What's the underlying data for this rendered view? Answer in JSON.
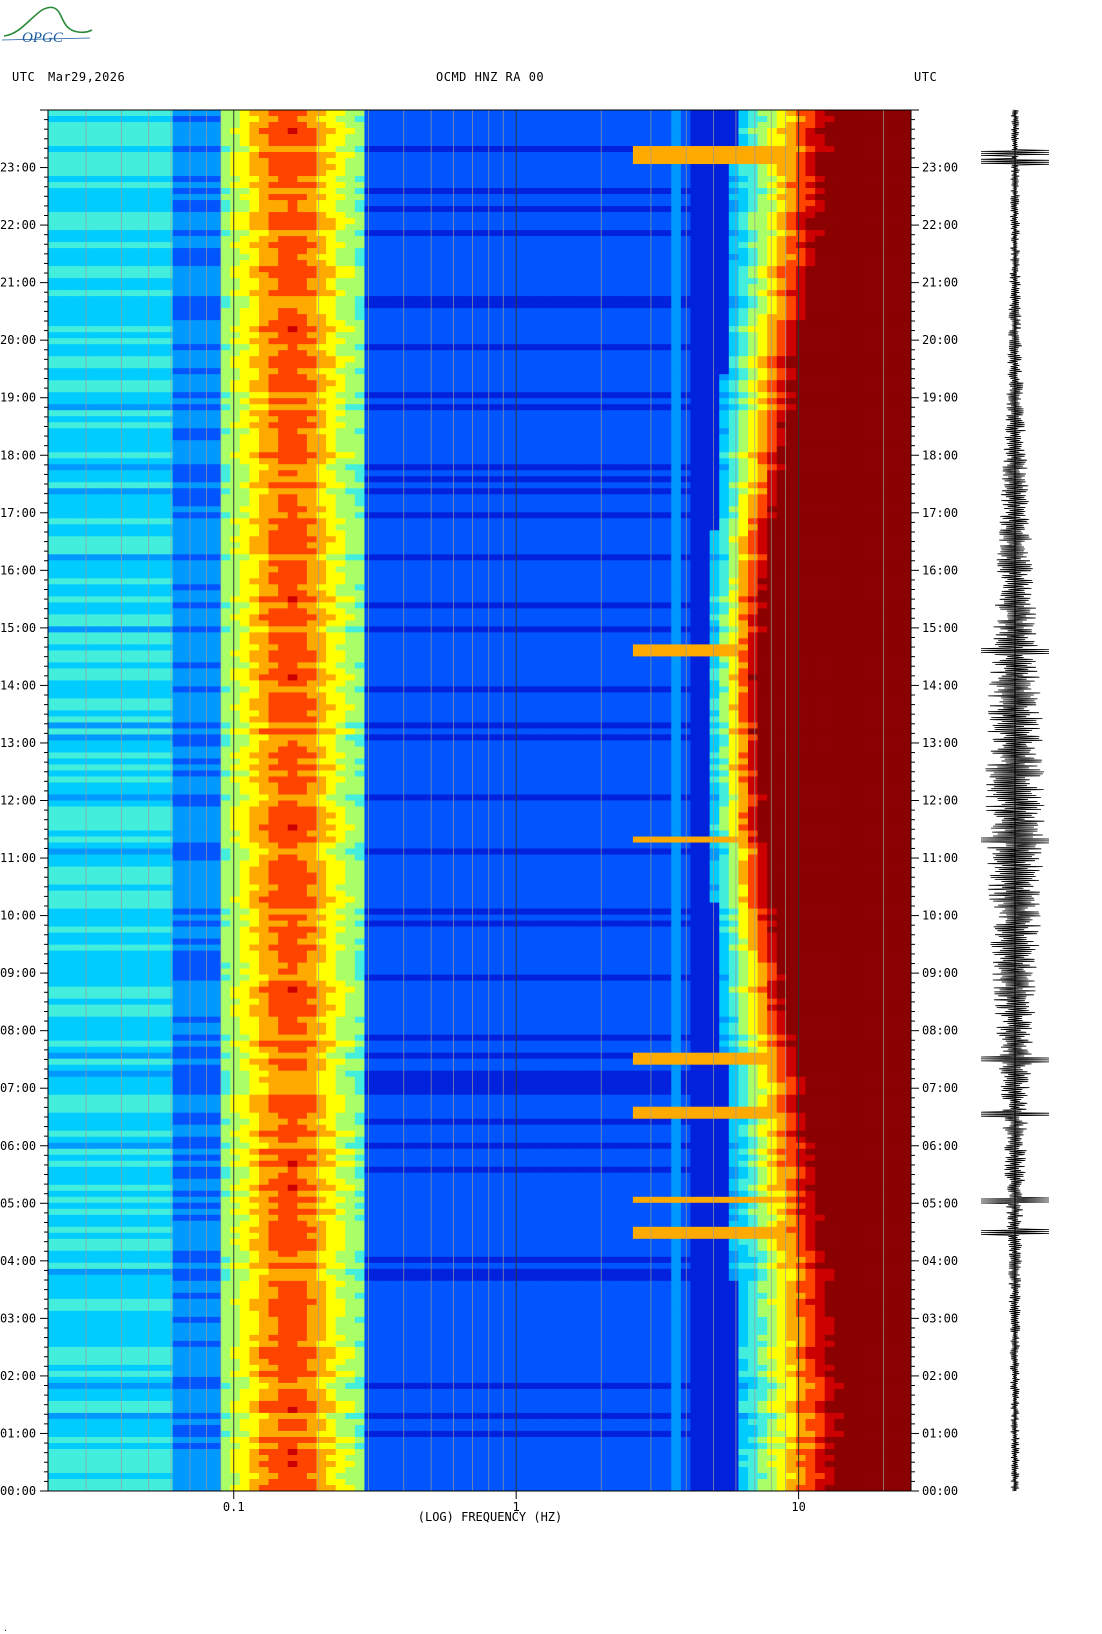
{
  "header": {
    "left_tz": "UTC",
    "date": "Mar29,2026",
    "station": "OCMD HNZ RA 00",
    "right_tz": "UTC"
  },
  "logo": {
    "text": "OPGC"
  },
  "chart_data": {
    "type": "heatmap",
    "title": "OCMD HNZ RA 00",
    "xlabel": "(LOG) FREQUENCY (HZ)",
    "x_scale": "log",
    "xlim": [
      0.022,
      25
    ],
    "x_ticks": [
      {
        "value": 0.1,
        "label": "0.1"
      },
      {
        "value": 1,
        "label": "1"
      },
      {
        "value": 10,
        "label": "10"
      }
    ],
    "y_hours": [
      "00:00",
      "01:00",
      "02:00",
      "03:00",
      "04:00",
      "05:00",
      "06:00",
      "07:00",
      "08:00",
      "09:00",
      "10:00",
      "11:00",
      "12:00",
      "13:00",
      "14:00",
      "15:00",
      "16:00",
      "17:00",
      "18:00",
      "19:00",
      "20:00",
      "21:00",
      "22:00",
      "23:00"
    ],
    "ylim_hours": [
      0,
      24
    ],
    "colormap": [
      "#0000aa",
      "#0022dd",
      "#0055ff",
      "#0099ff",
      "#00ccff",
      "#44eedd",
      "#aaff66",
      "#ffff00",
      "#ffaa00",
      "#ff4400",
      "#cc0000",
      "#8b0000"
    ],
    "events_hours": [
      4.5,
      5.05,
      6.55,
      7.5,
      23.1,
      23.25,
      14.6,
      11.3
    ],
    "seismogram_color": "#000000"
  }
}
